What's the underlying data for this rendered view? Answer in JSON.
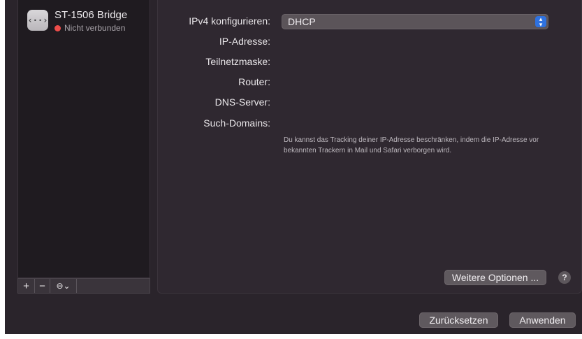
{
  "sidebar": {
    "service": {
      "icon": "network-bridge-icon",
      "name": "ST-1506 Bridge",
      "status": "Nicht verbunden",
      "status_color": "#ee4d4a"
    },
    "toolbar": {
      "add_label": "+",
      "remove_label": "−",
      "action_label": "⊖⌄"
    }
  },
  "main": {
    "ipv4_config_label": "IPv4 konfigurieren:",
    "ipv4_config_value": "DHCP",
    "ip_address_label": "IP-Adresse:",
    "subnet_mask_label": "Teilnetzmaske:",
    "router_label": "Router:",
    "dns_server_label": "DNS-Server:",
    "search_domains_label": "Such-Domains:",
    "tracking_note": "Du kannst das Tracking deiner IP-Adresse beschränken, indem die IP-Adresse vor bekannten Trackern in Mail und Safari verborgen wird.",
    "more_options_label": "Weitere Optionen ...",
    "help_label": "?"
  },
  "footer": {
    "reset_label": "Zurücksetzen",
    "apply_label": "Anwenden"
  },
  "colors": {
    "accent": "#2f72e0",
    "status_disconnected": "#ee4d4a"
  }
}
